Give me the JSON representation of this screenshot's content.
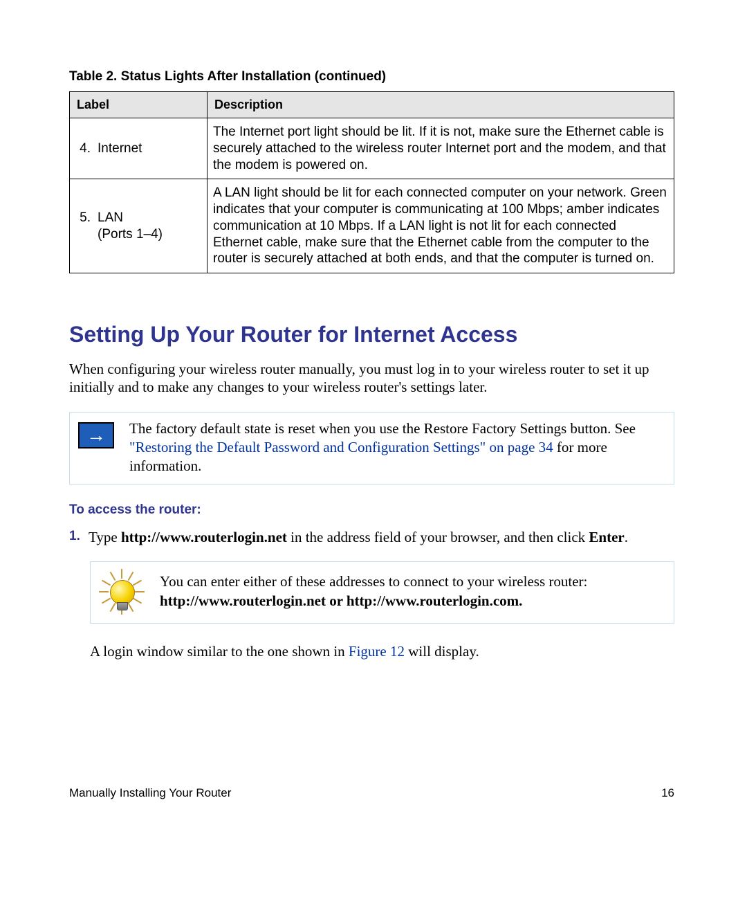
{
  "table": {
    "title": "Table 2.   Status Lights After Installation (continued)",
    "headers": {
      "label": "Label",
      "description": "Description"
    },
    "rows": [
      {
        "num": "4.",
        "name": "Internet",
        "suffix": "",
        "description": "The Internet port light should be lit. If it is not, make sure the Ethernet cable is securely attached to the wireless router Internet port and the modem, and that the modem is powered on."
      },
      {
        "num": "5.",
        "name": "LAN",
        "suffix": "(Ports 1–4)",
        "description": "A LAN light should be lit for each connected computer on your network. Green indicates that your computer is communicating at 100 Mbps; amber indicates communication at 10 Mbps. If a LAN light is not lit for each connected Ethernet cable, make sure that the Ethernet cable from the computer to the router is securely attached at both ends, and that the computer is turned on."
      }
    ]
  },
  "heading": "Setting Up Your Router for Internet Access",
  "intro": "When configuring your wireless router manually, you must log in to your wireless router to set it up initially and to make any changes to your wireless router's settings later.",
  "note": {
    "pre": "The factory default state is reset when you use the Restore Factory Settings button. See ",
    "link": "\"Restoring the Default Password and Configuration Settings\" on page 34",
    "post": " for more information."
  },
  "subhead": "To access the router:",
  "step1": {
    "num": "1.",
    "pre": "Type ",
    "bold1": "http://www.routerlogin.net",
    "mid": " in the address field of your browser, and then click ",
    "bold2": "Enter",
    "post": "."
  },
  "tip": {
    "line1": "You can enter either of these addresses to connect to your wireless router:",
    "line2": "http://www.routerlogin.net or http://www.routerlogin.com."
  },
  "after": {
    "pre": "A login window similar to the one shown in ",
    "link": "Figure 12",
    "post": " will display."
  },
  "footer": {
    "left": "Manually Installing Your Router",
    "right": "16"
  }
}
